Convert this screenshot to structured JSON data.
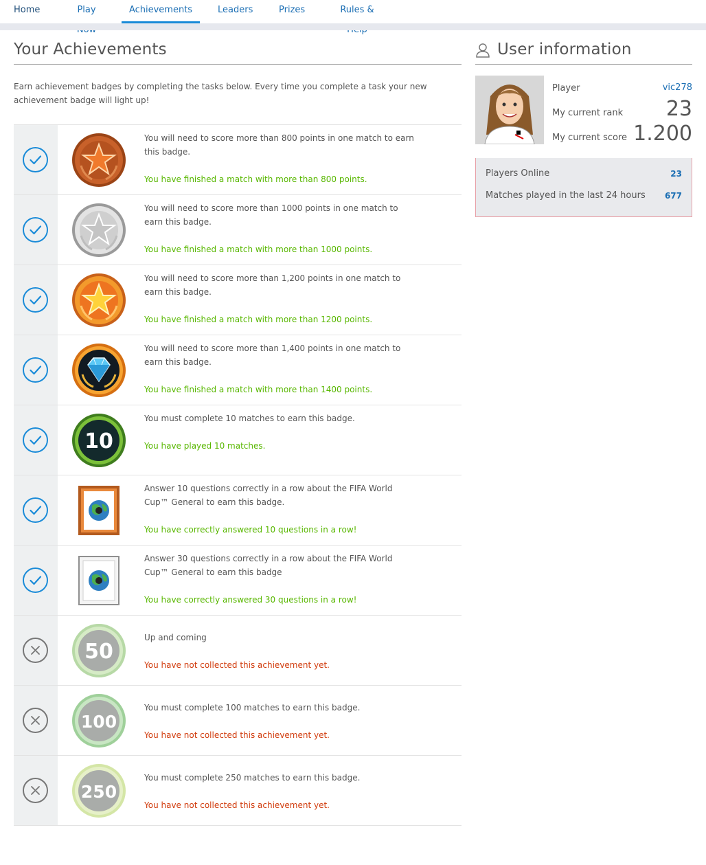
{
  "nav": {
    "items": [
      "Home",
      "Play Now",
      "Achievements",
      "Leaders",
      "Prizes",
      "Rules & Help"
    ],
    "active": "Achievements"
  },
  "achievements": {
    "title": "Your Achievements",
    "intro": "Earn achievement badges by completing the tasks below. Every time you complete a task your new achievement badge will light up!",
    "rows": [
      {
        "status": "earned",
        "badge": "bronze-star-badge",
        "description": "You will need to score more than 800 points in one match to earn this badge.",
        "result": "You have finished a match with more than 800 points."
      },
      {
        "status": "earned",
        "badge": "silver-star-badge",
        "description": "You will need to score more than 1000 points in one match to earn this badge.",
        "result": "You have finished a match with more than 1000 points."
      },
      {
        "status": "earned",
        "badge": "gold-star-badge",
        "description": "You will need to score more than 1,200 points in one match to earn this badge.",
        "result": "You have finished a match with more than 1200 points."
      },
      {
        "status": "earned",
        "badge": "diamond-badge",
        "description": "You will need to score more than 1,400 points in one match to earn this badge.",
        "result": "You have finished a match with more than 1400 points."
      },
      {
        "status": "earned",
        "badge": "10-matches-badge",
        "badge_text": "10",
        "description": "You must complete 10 matches to earn this badge.",
        "result": "You have played 10 matches."
      },
      {
        "status": "earned",
        "badge": "globe-frame-bronze-badge",
        "description": "Answer 10 questions correctly in a row about the FIFA World Cup™ General to earn this badge.",
        "result": "You have correctly answered 10 questions in a row!"
      },
      {
        "status": "earned",
        "badge": "globe-frame-white-badge",
        "description": "Answer 30 questions correctly in a row about the FIFA World Cup™ General to earn this badge",
        "result": "You have correctly answered 30 questions in a row!"
      },
      {
        "status": "locked",
        "badge": "50-matches-badge",
        "badge_text": "50",
        "description": "Up and coming",
        "result": "You have not collected this achievement yet."
      },
      {
        "status": "locked",
        "badge": "100-matches-badge",
        "badge_text": "100",
        "description": "You must complete 100 matches to earn this badge.",
        "result": "You have not collected this achievement yet."
      },
      {
        "status": "locked",
        "badge": "250-matches-badge",
        "badge_text": "250",
        "description": "You must complete 250 matches to earn this badge.",
        "result": "You have not collected this achievement yet."
      }
    ]
  },
  "user": {
    "title": "User information",
    "player_label": "Player",
    "player_value": "vic278",
    "rank_label": "My current rank",
    "rank_value": "23",
    "score_label": "My current score",
    "score_value": "1.200",
    "players_online_label": "Players Online",
    "players_online_value": "23",
    "matches_label": "Matches played in the last 24 hours",
    "matches_value": "677"
  },
  "colors": {
    "link": "#1c6fb4",
    "accent": "#1a8bd8",
    "success": "#58b700",
    "error": "#d13b0c"
  }
}
